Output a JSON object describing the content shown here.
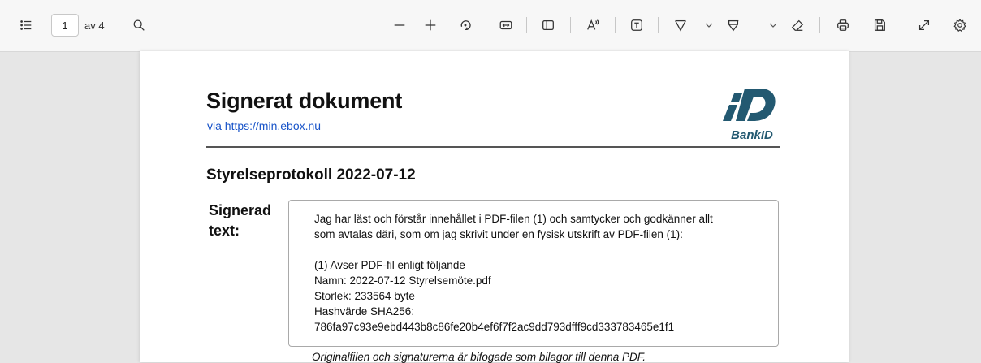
{
  "toolbar": {
    "page_current": "1",
    "page_of": "av 4",
    "icons": [
      "contents-icon",
      "search-icon",
      "zoom-out-icon",
      "zoom-in-icon",
      "rotate-icon",
      "fit-width-icon",
      "page-view-icon",
      "read-aloud-icon",
      "text-icon",
      "draw-icon",
      "chevron-down-icon",
      "highlight-icon",
      "chevron-down-icon",
      "eraser-icon",
      "print-icon",
      "save-icon",
      "fullscreen-icon",
      "settings-icon"
    ]
  },
  "document": {
    "title": "Signerat dokument",
    "link": "via https://min.ebox.nu",
    "logo_text": "BankID",
    "section_title": "Styrelseprotokoll 2022-07-12",
    "signed_label": "Signerad text:",
    "signed_text": {
      "line1": "Jag har läst och förstår innehållet i PDF-filen (1) och samtycker och godkänner allt",
      "line2": "som avtalas däri, som om jag skrivit under en fysisk utskrift av PDF-filen (1):",
      "line3": "(1) Avser PDF-fil enligt följande",
      "line4": "Namn: 2022-07-12 Styrelsemöte.pdf",
      "line5": "Storlek: 233564 byte",
      "line6": "Hashvärde SHA256:",
      "line7": "786fa97c93e9ebd443b8c86fe20b4ef6f7f2ac9dd793dfff9cd333783465e1f1"
    },
    "footnote": "Originalfilen och signaturerna är bifogade som bilagor till denna PDF."
  },
  "colors": {
    "link": "#1a55c9",
    "bankid_blue": "#235971",
    "toolbar_bg": "#f7f7f7",
    "viewer_bg": "#e6e6e6"
  }
}
